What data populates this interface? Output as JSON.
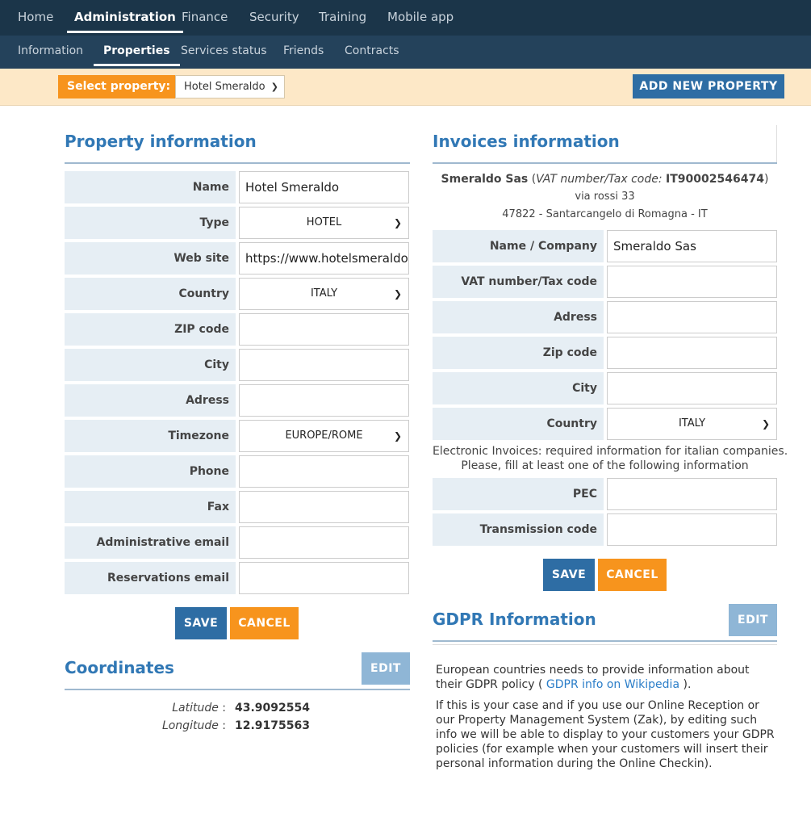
{
  "topnav": [
    {
      "label": "Home",
      "active": false
    },
    {
      "label": "Administration",
      "active": true
    },
    {
      "label": "Finance",
      "active": false
    },
    {
      "label": "Security",
      "active": false
    },
    {
      "label": "Training",
      "active": false
    },
    {
      "label": "Mobile app",
      "active": false
    }
  ],
  "subnav": [
    {
      "label": "Information",
      "active": false
    },
    {
      "label": "Properties",
      "active": true
    },
    {
      "label": "Services status",
      "active": false
    },
    {
      "label": "Friends",
      "active": false
    },
    {
      "label": "Contracts",
      "active": false
    }
  ],
  "property_bar": {
    "select_label": "Select property:",
    "selected": "Hotel Smeraldo",
    "add_button": "ADD NEW PROPERTY"
  },
  "property_info": {
    "title": "Property information",
    "fields": {
      "name": {
        "label": "Name",
        "value": "Hotel Smeraldo"
      },
      "type": {
        "label": "Type",
        "value": "HOTEL"
      },
      "website": {
        "label": "Web site",
        "value": "https://www.hotelsmeraldo"
      },
      "country": {
        "label": "Country",
        "value": "ITALY"
      },
      "zip": {
        "label": "ZIP code",
        "value": ""
      },
      "city": {
        "label": "City",
        "value": ""
      },
      "address": {
        "label": "Adress",
        "value": ""
      },
      "timezone": {
        "label": "Timezone",
        "value": "EUROPE/ROME"
      },
      "phone": {
        "label": "Phone",
        "value": ""
      },
      "fax": {
        "label": "Fax",
        "value": ""
      },
      "admin_email": {
        "label": "Administrative email",
        "value": ""
      },
      "res_email": {
        "label": "Reservations email",
        "value": ""
      }
    },
    "save": "SAVE",
    "cancel": "CANCEL"
  },
  "coordinates": {
    "title": "Coordinates",
    "edit": "EDIT",
    "lat_label": "Latitude",
    "lat_value": "43.9092554",
    "lon_label": "Longitude",
    "lon_value": "12.9175563"
  },
  "invoices": {
    "title": "Invoices information",
    "company": "Smeraldo Sas",
    "vat_label": "VAT number/Tax code:",
    "vat_value": "IT90002546474",
    "street": "via rossi 33",
    "city_line": "47822 - Santarcangelo di Romagna - IT",
    "fields": {
      "company": {
        "label": "Name / Company",
        "value": "Smeraldo Sas"
      },
      "vat": {
        "label": "VAT number/Tax code",
        "value": ""
      },
      "address": {
        "label": "Adress",
        "value": ""
      },
      "zip": {
        "label": "Zip code",
        "value": ""
      },
      "city": {
        "label": "City",
        "value": ""
      },
      "country": {
        "label": "Country",
        "value": "ITALY"
      },
      "pec": {
        "label": "PEC",
        "value": ""
      },
      "transmission": {
        "label": "Transmission code",
        "value": ""
      }
    },
    "einvoice_line1": "Electronic Invoices: required information for italian companies.",
    "einvoice_line2": "Please, fill at least one of the following information",
    "save": "SAVE",
    "cancel": "CANCEL"
  },
  "gdpr": {
    "title": "GDPR Information",
    "edit": "EDIT",
    "p1_start": "European countries needs to provide information about their GDPR policy (",
    "p1_link": "GDPR info on Wikipedia",
    "p1_end": ").",
    "p2": "If this is your case and if you use our Online Reception or our Property Management System (Zak), by editing such info we will be able to display to your customers your GDPR policies (for example when your customers will insert their personal information during the Online Checkin)."
  },
  "colors": {
    "nav_bg": "#1b3549",
    "subnav_bg": "#24425b",
    "accent_blue": "#2e6da4",
    "accent_orange": "#f7941d",
    "title_blue": "#3178b5",
    "label_bg": "#e6eef4"
  }
}
